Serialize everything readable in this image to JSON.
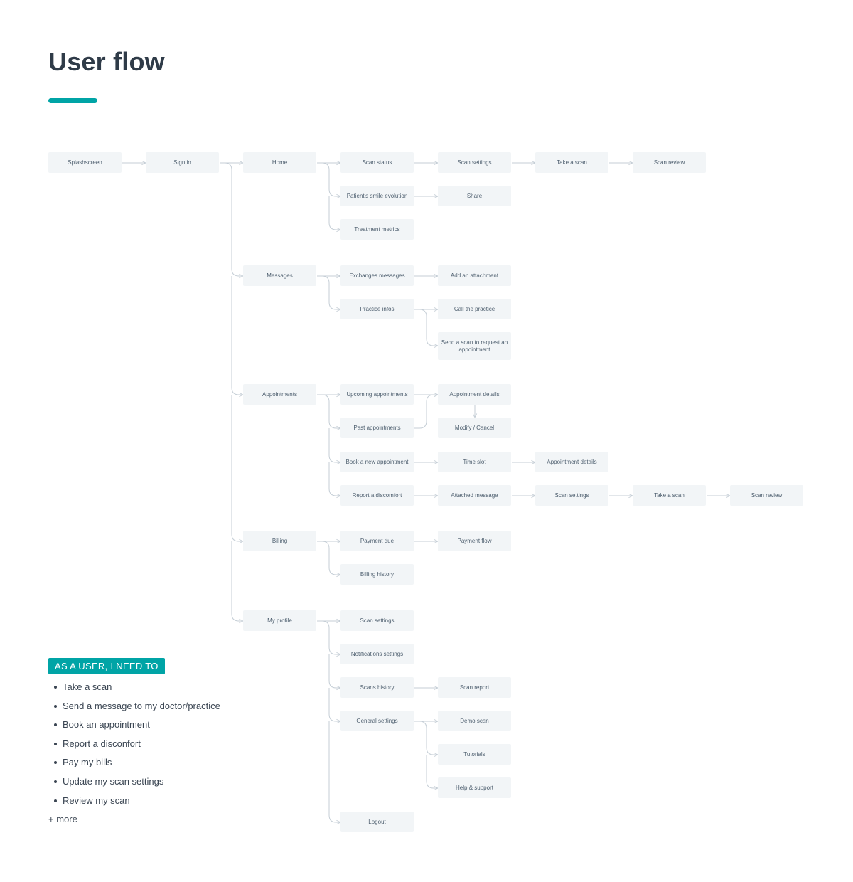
{
  "page": {
    "title": "User flow",
    "accent_color": "#00a4a6"
  },
  "nodes": {
    "splash": "Splashscreen",
    "signin": "Sign in",
    "home": "Home",
    "messages": "Messages",
    "appointments": "Appointments",
    "billing": "Billing",
    "profile": "My profile",
    "scan_status": "Scan status",
    "smile_evolution": "Patient's smile evolution",
    "treatment_metrics": "Treatment metrics",
    "home_scan_settings": "Scan settings",
    "home_share": "Share",
    "home_take_scan": "Take a scan",
    "home_scan_review": "Scan review",
    "exchanges_messages": "Exchanges messages",
    "practice_infos": "Practice infos",
    "add_attachment": "Add an attachment",
    "call_practice": "Call the practice",
    "send_scan_request": "Send a scan to request an appointment",
    "upcoming_appointments": "Upcoming appointments",
    "past_appointments": "Past appointments",
    "book_appointment": "Book a new appointment",
    "report_discomfort": "Report a discomfort",
    "appointment_details": "Appointment details",
    "modify_cancel": "Modify / Cancel",
    "time_slot": "Time slot",
    "appointment_details_2": "Appointment details",
    "attached_message": "Attached message",
    "disc_scan_settings": "Scan settings",
    "disc_take_scan": "Take a scan",
    "disc_scan_review": "Scan review",
    "payment_due": "Payment due",
    "billing_history": "Billing history",
    "payment_flow": "Payment flow",
    "profile_scan_settings": "Scan settings",
    "notifications_settings": "Notifications settings",
    "scans_history": "Scans history",
    "general_settings": "General settings",
    "logout": "Logout",
    "scan_report": "Scan report",
    "demo_scan": "Demo scan",
    "tutorials": "Tutorials",
    "help_support": "Help & support"
  },
  "needs": {
    "badge": "AS A USER, I NEED TO",
    "items": [
      "Take a scan",
      "Send a message to my doctor/practice",
      "Book an appointment",
      "Report a disconfort",
      "Pay my bills",
      "Update my scan settings",
      "Review my scan"
    ],
    "more": "+ more"
  },
  "colors": {
    "node_bg": "#f2f5f7",
    "node_text": "#4d5e6e",
    "connector": "#c5ced6",
    "title_text": "#2f3b48"
  }
}
